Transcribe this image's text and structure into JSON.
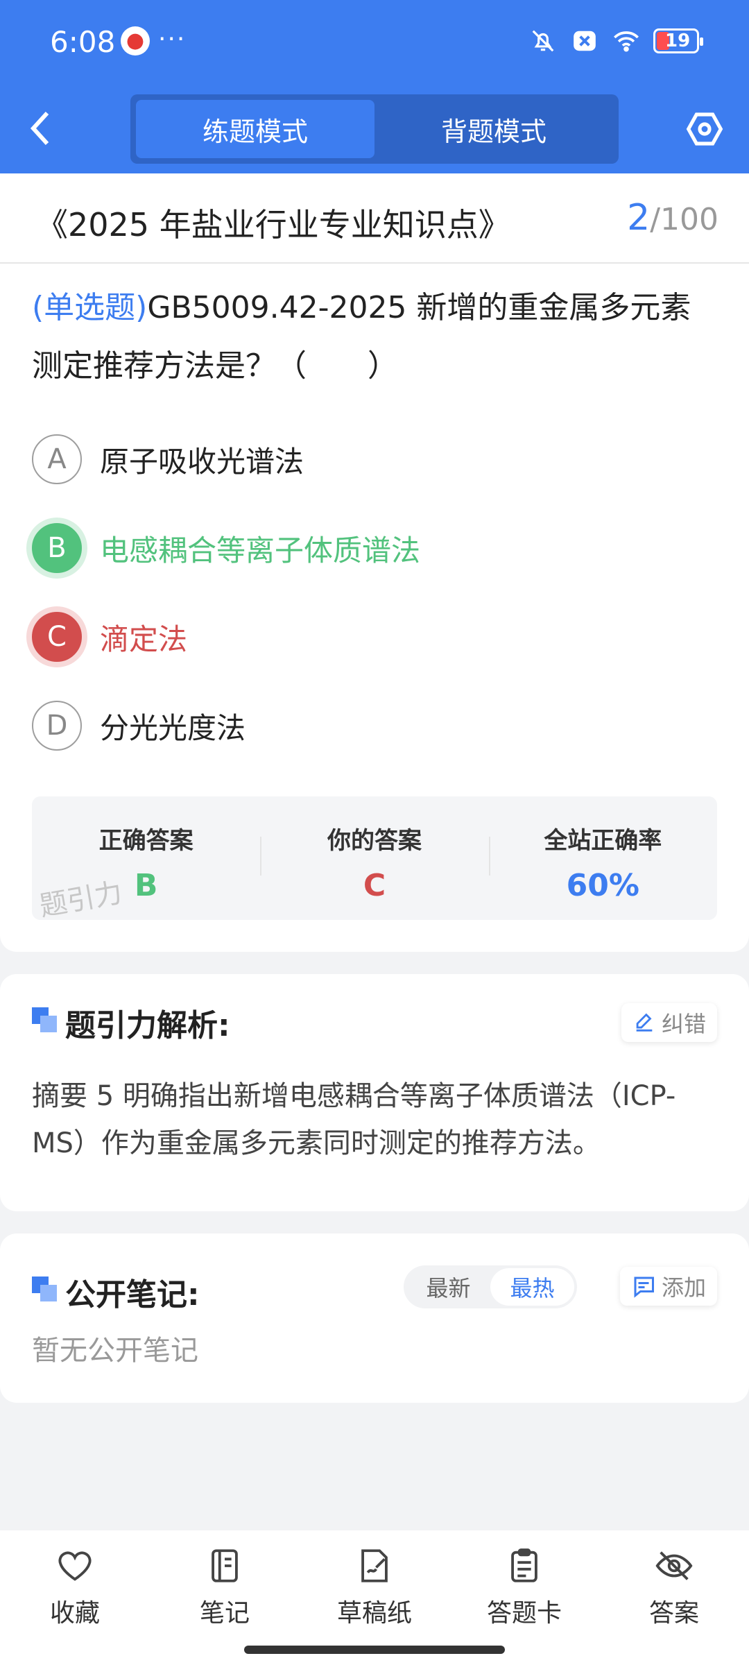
{
  "status_bar": {
    "time": "6:08",
    "dots": "···",
    "battery": "19"
  },
  "header": {
    "modes": [
      {
        "label": "练题模式",
        "active": true
      },
      {
        "label": "背题模式",
        "active": false
      }
    ]
  },
  "paper": {
    "title": "《2025 年盐业行业专业知识点》",
    "current": "2",
    "total": "/100"
  },
  "question": {
    "type": "(单选题)",
    "text": "GB5009.42-2025 新增的重金属多元素测定推荐方法是？（　　）",
    "options": [
      {
        "letter": "A",
        "text": "原子吸收光谱法",
        "state": "normal"
      },
      {
        "letter": "B",
        "text": "电感耦合等离子体质谱法",
        "state": "correct"
      },
      {
        "letter": "C",
        "text": "滴定法",
        "state": "wrong"
      },
      {
        "letter": "D",
        "text": "分光光度法",
        "state": "normal"
      }
    ]
  },
  "answer_summary": {
    "correct_label": "正确答案",
    "correct_value": "B",
    "yours_label": "你的答案",
    "yours_value": "C",
    "rate_label": "全站正确率",
    "rate_value": "60%",
    "watermark": "题引力"
  },
  "analysis": {
    "title": "题引力解析:",
    "report_label": "纠错",
    "text": "摘要 5 明确指出新增电感耦合等离子体质谱法（ICP-MS）作为重金属多元素同时测定的推荐方法。"
  },
  "notes": {
    "title": "公开笔记:",
    "sort_new": "最新",
    "sort_hot": "最热",
    "add_label": "添加",
    "empty": "暂无公开笔记"
  },
  "bottom_bar": {
    "items": [
      {
        "label": "收藏",
        "icon": "heart-icon"
      },
      {
        "label": "笔记",
        "icon": "notebook-icon"
      },
      {
        "label": "草稿纸",
        "icon": "draft-icon"
      },
      {
        "label": "答题卡",
        "icon": "clipboard-icon"
      },
      {
        "label": "答案",
        "icon": "eye-off-icon"
      }
    ]
  },
  "colors": {
    "primary": "#3d7df0",
    "correct": "#52c27d",
    "wrong": "#d24d4d"
  }
}
